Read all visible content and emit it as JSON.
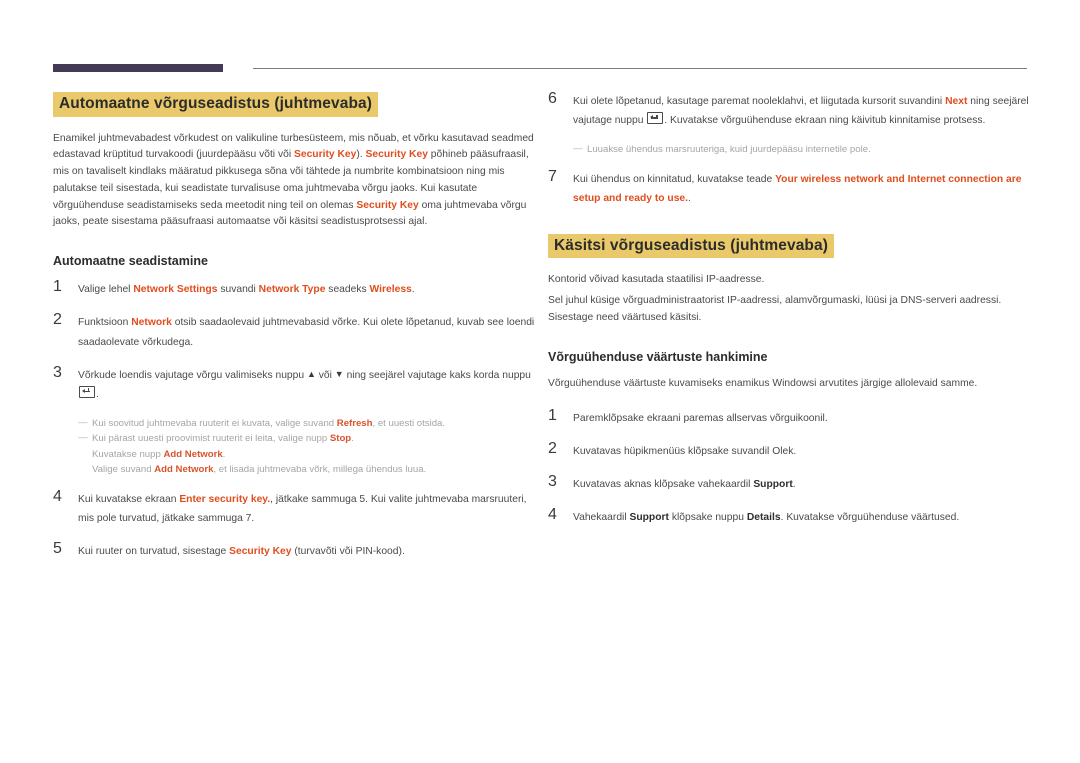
{
  "header": {
    "rule_color_thick": "#433b55",
    "rule_color_thin": "#7c7c7c"
  },
  "colors": {
    "highlight": "#e9c969",
    "accent": "#e04e1f",
    "note_text": "#a8a4a0",
    "body_text": "#4a4a4a"
  },
  "left": {
    "title": "Automaatne võrguseadistus (juhtmevaba)",
    "intro_1": "Enamikel juhtmevabadest võrkudest on valikuline turbesüsteem, mis nõuab, et võrku kasutavad seadmed edastavad krüptitud turvakoodi (juurdepääsu võti või ",
    "intro_key_1": "Security Key",
    "intro_2": "). ",
    "intro_key_2": "Security Key",
    "intro_3": " põhineb pääsufraasil, mis on tavaliselt kindlaks määratud pikkusega sõna või tähtede ja numbrite kombinatsioon ning mis palutakse teil sisestada, kui seadistate turvalisuse oma juhtmevaba võrgu jaoks. Kui kasutate võrguühenduse seadistamiseks seda meetodit ning teil on olemas ",
    "intro_key_3": "Security Key",
    "intro_4": " oma juhtmevaba võrgu jaoks, peate sisestama pääsufraasi automaatse või käsitsi seadistusprotsessi ajal.",
    "subtitle": "Automaatne seadistamine",
    "steps": [
      {
        "num": "1",
        "p1": "Valige lehel ",
        "a1": "Network Settings",
        "p2": " suvandi ",
        "a2": "Network Type",
        "p3": " seadeks ",
        "a3": "Wireless",
        "p4": "."
      },
      {
        "num": "2",
        "p1": "Funktsioon ",
        "a1": "Network",
        "p2": " otsib saadaolevaid juhtmevabasid võrke. Kui olete lõpetanud, kuvab see loendi saadaolevate võrkudega."
      },
      {
        "num": "3",
        "p1": "Võrkude loendis vajutage võrgu valimiseks nuppu ",
        "glyph_up": "▲",
        "p2": " või ",
        "glyph_down": "▼",
        "p3": " ning seejärel vajutage kaks korda nuppu ",
        "glyph_enter": "enter-key-icon",
        "p4": "."
      },
      {
        "num": "4",
        "p1": "Kui kuvatakse ekraan ",
        "a1": "Enter security key.",
        "p2": ", jätkake sammuga 5. Kui valite juhtmevaba marsruuteri, mis pole turvatud, jätkake sammuga 7."
      },
      {
        "num": "5",
        "p1": "Kui ruuter on turvatud, sisestage ",
        "a1": "Security Key",
        "p2": " (turvavõti või PIN-kood)."
      }
    ],
    "notes": [
      {
        "dash": "—",
        "p1": "Kui soovitud juhtmevaba ruuterit ei kuvata, valige suvand ",
        "a1": "Refresh",
        "p2": ", et uuesti otsida."
      },
      {
        "dash": "—",
        "p1": "Kui pärast uuesti proovimist ruuterit ei leita, valige nupp ",
        "a1": "Stop",
        "p2": "."
      }
    ],
    "notes_cont": [
      {
        "p1": "Kuvatakse nupp ",
        "a1": "Add Network",
        "p2": "."
      },
      {
        "p1": "Valige suvand ",
        "a1": "Add Network",
        "p2": ", et lisada juhtmevaba võrk, millega ühendus luua."
      }
    ]
  },
  "right": {
    "steps_top": [
      {
        "num": "6",
        "p1": "Kui olete lõpetanud, kasutage paremat nooleklahvi, et liigutada kursorit suvandini ",
        "a1": "Next",
        "p2": " ning seejärel vajutage nuppu ",
        "glyph_enter": "enter-key-icon",
        "p3": ". Kuvatakse võrguühenduse ekraan ning käivitub kinnitamise protsess."
      }
    ],
    "note": {
      "dash": "—",
      "text": "Luuakse ühendus marsruuteriga, kuid juurdepääsu internetile pole."
    },
    "step7": {
      "num": "7",
      "p1": "Kui ühendus on kinnitatud, kuvatakse teade ",
      "a1": "Your wireless network and Internet connection are setup and ready to use.",
      "p2": "."
    },
    "title": "Käsitsi võrguseadistus (juhtmevaba)",
    "para_1": "Kontorid võivad kasutada staatilisi IP-aadresse.",
    "para_2": "Sel juhul küsige võrguadministraatorist IP-aadressi, alamvõrgumaski, lüüsi ja DNS-serveri aadressi. Sisestage need väärtused käsitsi.",
    "subtitle": "Võrguühenduse väärtuste hankimine",
    "para_3": "Võrguühenduse väärtuste kuvamiseks enamikus Windowsi arvutites järgige allolevaid samme.",
    "steps": [
      {
        "num": "1",
        "p1": "Paremklõpsake ekraani paremas allservas võrguikoonil."
      },
      {
        "num": "2",
        "p1": "Kuvatavas hüpikmenüüs klõpsake suvandil Olek."
      },
      {
        "num": "3",
        "p1": "Kuvatavas aknas klõpsake vahekaardil ",
        "s1": "Support",
        "p2": "."
      },
      {
        "num": "4",
        "p1": "Vahekaardil ",
        "s1": "Support",
        "p2": " klõpsake nuppu ",
        "s2": "Details",
        "p3": ". Kuvatakse võrguühenduse väärtused."
      }
    ]
  }
}
